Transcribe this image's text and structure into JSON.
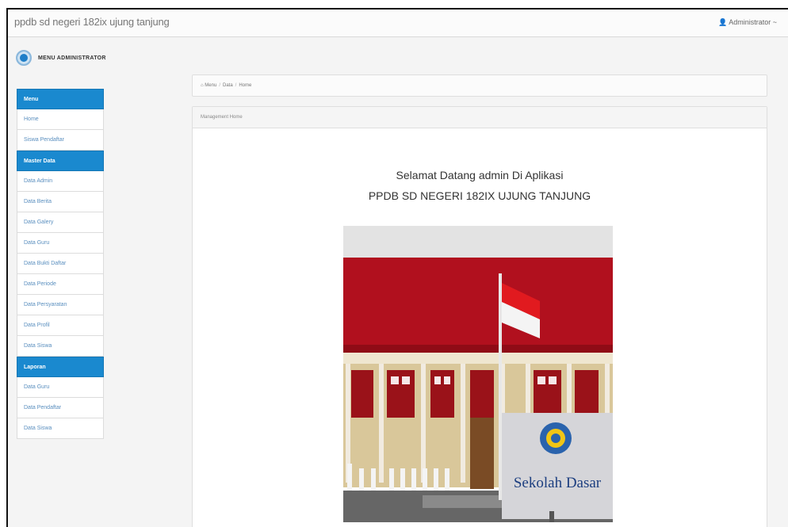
{
  "app": {
    "title": "ppdb sd negeri 182ix ujung tanjung",
    "user": "Administrator ~"
  },
  "brand_menu": "MENU ADMINISTRATOR",
  "sidebar": [
    {
      "type": "head",
      "label": "Menu"
    },
    {
      "type": "item",
      "label": "Home"
    },
    {
      "type": "item",
      "label": "Siswa Pendaftar"
    },
    {
      "type": "head",
      "label": "Master Data"
    },
    {
      "type": "item",
      "label": "Data Admin"
    },
    {
      "type": "item",
      "label": "Data Berita"
    },
    {
      "type": "item",
      "label": "Data Galery"
    },
    {
      "type": "item",
      "label": "Data Guru"
    },
    {
      "type": "item",
      "label": "Data Bukti Daftar"
    },
    {
      "type": "item",
      "label": "Data Periode"
    },
    {
      "type": "item",
      "label": "Data Persyaratan"
    },
    {
      "type": "item",
      "label": "Data Profil"
    },
    {
      "type": "item",
      "label": "Data Siswa"
    },
    {
      "type": "head",
      "label": "Laporan"
    },
    {
      "type": "item",
      "label": "Data Guru"
    },
    {
      "type": "item",
      "label": "Data Pendaftar"
    },
    {
      "type": "item",
      "label": "Data Siswa"
    }
  ],
  "breadcrumb": [
    "Menu",
    "Data",
    "Home"
  ],
  "panel": {
    "title": "Management Home",
    "welcome_line1": "Selamat Datang admin Di Aplikasi",
    "welcome_line2": "PPDB SD NEGERI 182IX UJUNG TANJUNG",
    "sign_text": "Sekolah Dasar"
  },
  "colors": {
    "accent": "#1a89cf",
    "roof": "#b1101e",
    "wall": "#d9c79a",
    "sign": "#d5d5d9"
  }
}
